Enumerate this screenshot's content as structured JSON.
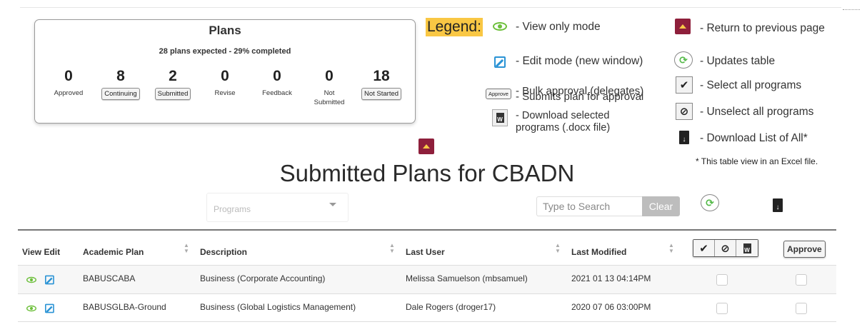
{
  "plans": {
    "title": "Plans",
    "subtitle": "28 plans expected - 29% completed",
    "stats": [
      {
        "value": "0",
        "label": "Approved"
      },
      {
        "value": "8",
        "label": "Continuing"
      },
      {
        "value": "2",
        "label": "Submitted"
      },
      {
        "value": "0",
        "label": "Revise"
      },
      {
        "value": "0",
        "label": "Feedback"
      },
      {
        "value": "0",
        "label": "Not Submitted"
      },
      {
        "value": "18",
        "label": "Not Started"
      }
    ]
  },
  "legend": {
    "title": "Legend:",
    "view_only": "- View only mode",
    "edit_mode": "- Edit mode (new window)",
    "approve_icon_label": "Approve",
    "bulk_approval": "- Bulk approval (delegates)",
    "submits_plan": "- Submits plan for approval",
    "download_selected": "- Download selected programs (.docx file)",
    "return_prev": "- Return to previous page",
    "updates_table": "- Updates table",
    "select_all": "- Select all programs",
    "unselect_all": "- Unselect all programs",
    "download_all": "- Download List of All*",
    "footnote": "* This table view in an Excel file."
  },
  "page": {
    "title": "Submitted Plans for CBADN"
  },
  "filters": {
    "programs_placeholder": "Programs",
    "search_placeholder": "Type to Search",
    "clear_label": "Clear"
  },
  "table": {
    "headers": {
      "view_edit": "View Edit",
      "academic_plan": "Academic Plan",
      "description": "Description",
      "last_user": "Last User",
      "last_modified": "Last Modified",
      "approve": "Approve"
    },
    "rows": [
      {
        "plan": "BABUSCABA",
        "description": "Business (Corporate Accounting)",
        "last_user": "Melissa Samuelson (mbsamuel)",
        "last_modified": "2021 01 13 04:14PM"
      },
      {
        "plan": "BABUSGLBA-Ground",
        "description": "Business (Global Logistics Management)",
        "last_user": "Dale Rogers (droger17)",
        "last_modified": "2020 07 06 03:00PM"
      }
    ]
  },
  "colors": {
    "accent_maroon": "#8e1f3b",
    "legend_highlight": "#f9c744",
    "view_green": "#6cbf3a",
    "edit_blue": "#2a93d5"
  }
}
